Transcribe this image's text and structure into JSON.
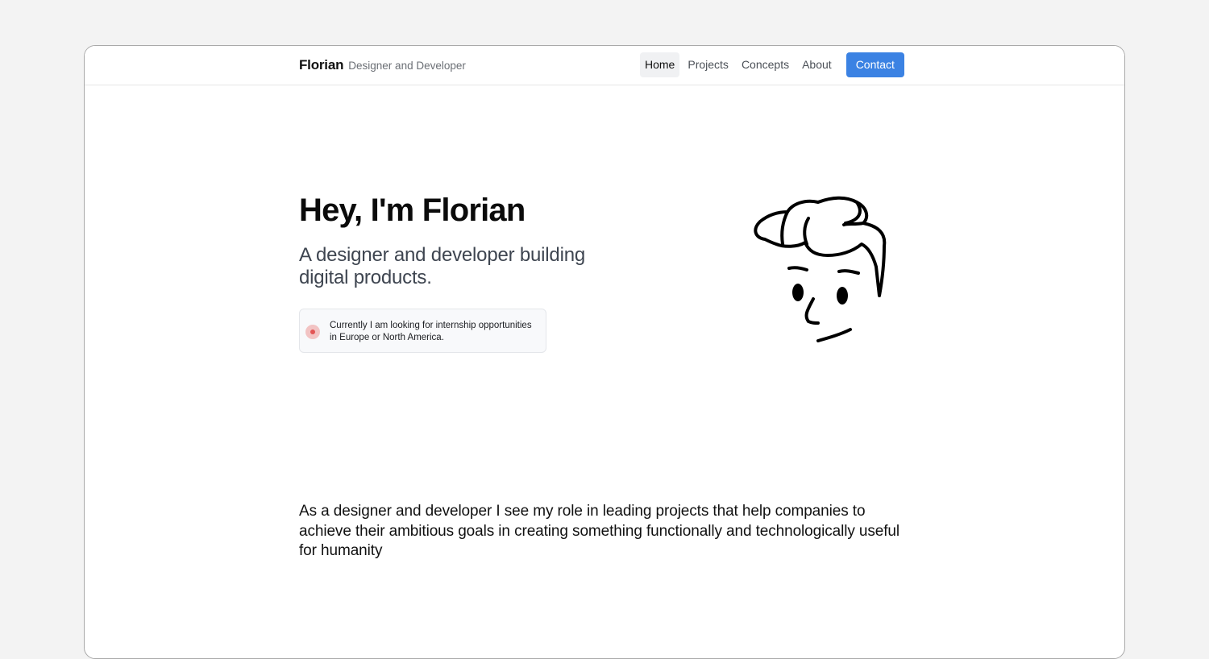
{
  "nav": {
    "brand_name": "Florian",
    "brand_tagline": "Designer and Developer",
    "links": [
      {
        "label": "Home",
        "active": true
      },
      {
        "label": "Projects",
        "active": false
      },
      {
        "label": "Concepts",
        "active": false
      },
      {
        "label": "About",
        "active": false
      }
    ],
    "contact_label": "Contact"
  },
  "hero": {
    "title": "Hey, I'm Florian",
    "subtitle": "A designer and developer building digital products.",
    "status": {
      "text": "Currently I am looking for internship opportunities in Europe or North America."
    },
    "illustration_icon": "face-doodle-icon"
  },
  "about": {
    "text": "As a designer and developer I see my role in leading projects that help companies to achieve their ambitious goals in creating something functionally and technologically useful for humanity"
  },
  "colors": {
    "accent": "#3b82e3",
    "status_dot": "#e25454",
    "status_dot_halo": "#f2c3c3",
    "page_background": "#f3f3f3"
  }
}
